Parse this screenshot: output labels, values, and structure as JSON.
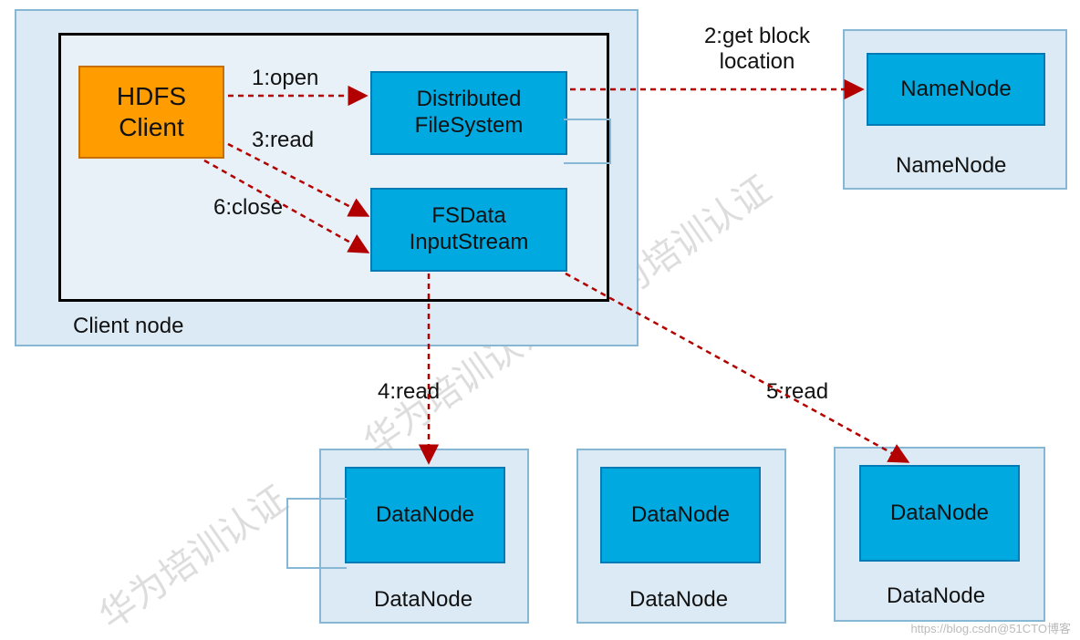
{
  "client_panel_label": "Client node",
  "hdfs_client": "HDFS\nClient",
  "distributed_fs": "Distributed\nFileSystem",
  "fsdata": "FSData\nInputStream",
  "namenode_box": "NameNode",
  "namenode_panel_label": "NameNode",
  "datanode_box": "DataNode",
  "datanode_panel_label": "DataNode",
  "labels": {
    "l1": "1:open",
    "l2": "2:get block\nlocation",
    "l3": "3:read",
    "l4": "4:read",
    "l5": "5:read",
    "l6": "6:close"
  },
  "watermark_text": "华为培训认证",
  "watermark_text2": "华为培",
  "footer": "https://blog.csdn@51CTO博客"
}
